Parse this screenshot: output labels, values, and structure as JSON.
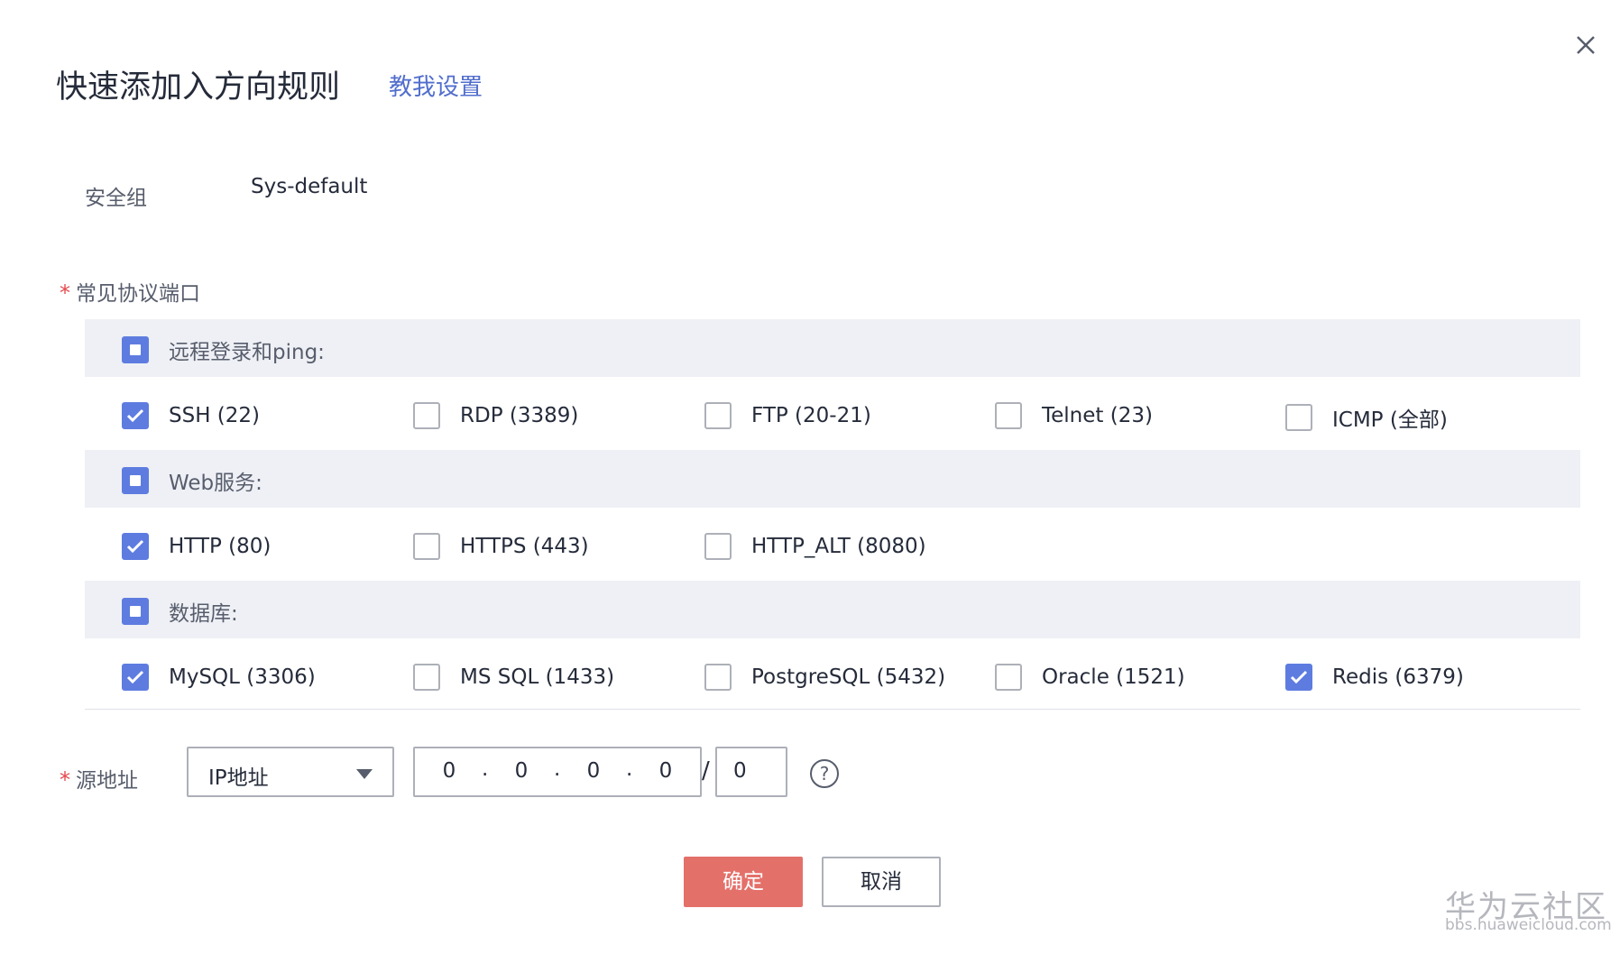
{
  "dialog": {
    "title": "快速添加入方向规则",
    "help_link": "教我设置",
    "close_icon": "close-icon"
  },
  "security_group": {
    "label": "安全组",
    "value": "Sys-default"
  },
  "ports": {
    "required_mark": "*",
    "label": "常见协议端口",
    "groups": [
      {
        "label": "远程登录和ping:",
        "state": "partial",
        "items": [
          {
            "label": "SSH (22)",
            "checked": true
          },
          {
            "label": "RDP (3389)",
            "checked": false
          },
          {
            "label": "FTP (20-21)",
            "checked": false
          },
          {
            "label": "Telnet (23)",
            "checked": false
          },
          {
            "label": "ICMP (全部)",
            "checked": false
          }
        ]
      },
      {
        "label": "Web服务:",
        "state": "partial",
        "items": [
          {
            "label": "HTTP (80)",
            "checked": true
          },
          {
            "label": "HTTPS (443)",
            "checked": false
          },
          {
            "label": "HTTP_ALT (8080)",
            "checked": false
          }
        ]
      },
      {
        "label": "数据库:",
        "state": "partial",
        "items": [
          {
            "label": "MySQL (3306)",
            "checked": true
          },
          {
            "label": "MS SQL (1433)",
            "checked": false
          },
          {
            "label": "PostgreSQL (5432)",
            "checked": false
          },
          {
            "label": "Oracle (1521)",
            "checked": false
          },
          {
            "label": "Redis (6379)",
            "checked": true
          }
        ]
      }
    ]
  },
  "source": {
    "required_mark": "*",
    "label": "源地址",
    "type_select": "IP地址",
    "ip_segments": [
      "0",
      "0",
      "0",
      "0"
    ],
    "ip_separator": ".",
    "slash": "/",
    "mask": "0",
    "help_icon": "question-circle-icon",
    "help_glyph": "?"
  },
  "footer": {
    "ok_label": "确定",
    "cancel_label": "取消"
  },
  "watermark": {
    "name": "华为云社区",
    "url": "bbs.huaweicloud.com"
  },
  "colors": {
    "accent": "#5e7ce0",
    "link": "#526ecc",
    "primary_button": "#e4706a",
    "required": "#e5484d",
    "group_band": "#eef0f5"
  }
}
